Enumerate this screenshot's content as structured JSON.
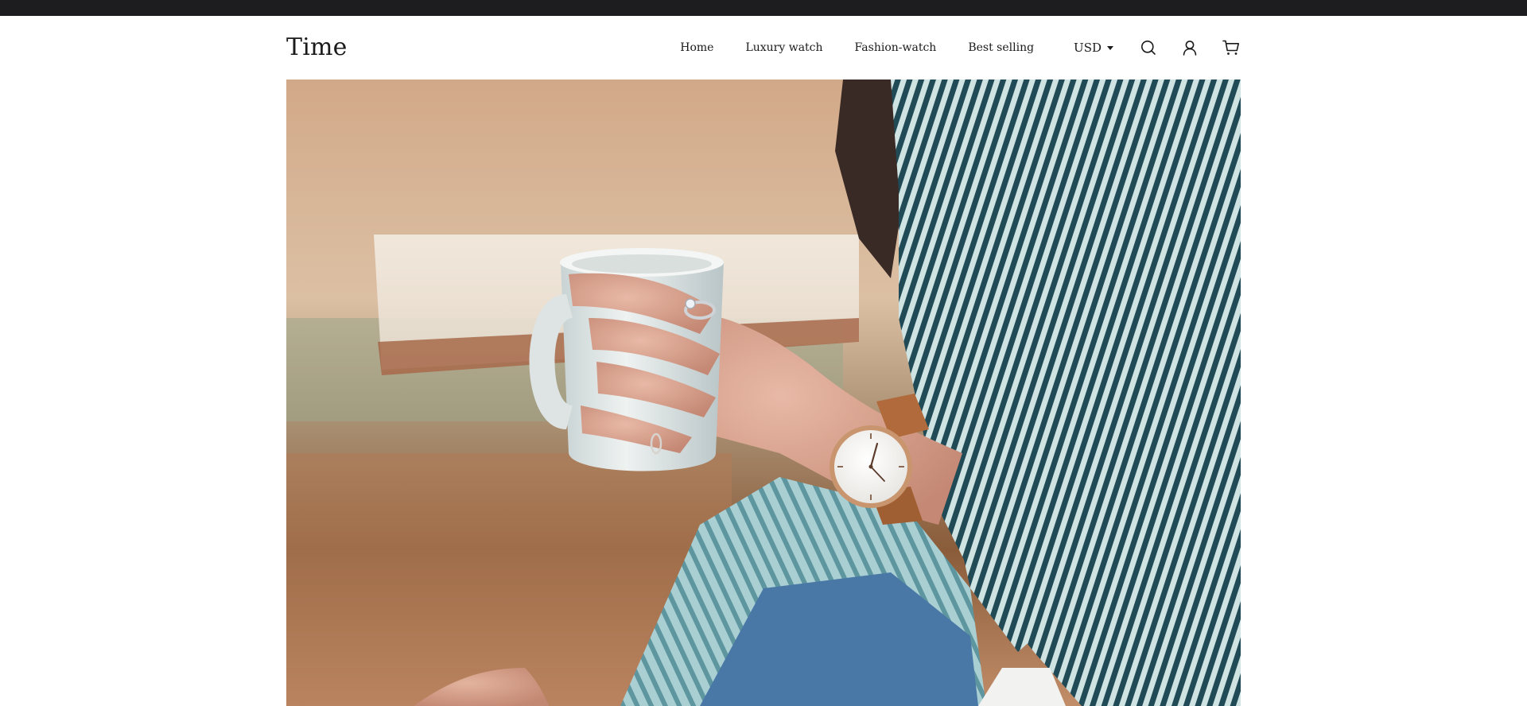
{
  "brand": {
    "logo": "Time"
  },
  "nav": {
    "items": [
      {
        "label": "Home"
      },
      {
        "label": "Luxury watch"
      },
      {
        "label": "Fashion-watch"
      },
      {
        "label": "Best selling"
      }
    ]
  },
  "currency": {
    "selected": "USD"
  },
  "icons": {
    "search": "search-icon",
    "account": "user-icon",
    "cart": "cart-icon"
  },
  "hero": {
    "subject": "woman holding mug wearing watch"
  },
  "colors": {
    "top_bar": "#1d1d1f",
    "text": "#1a1a1a",
    "shirt_stripe": "#1f4a56",
    "shirt_light": "#9cc4c8",
    "watch_strap": "#b06a3b",
    "mug": "#dfe6e6"
  }
}
